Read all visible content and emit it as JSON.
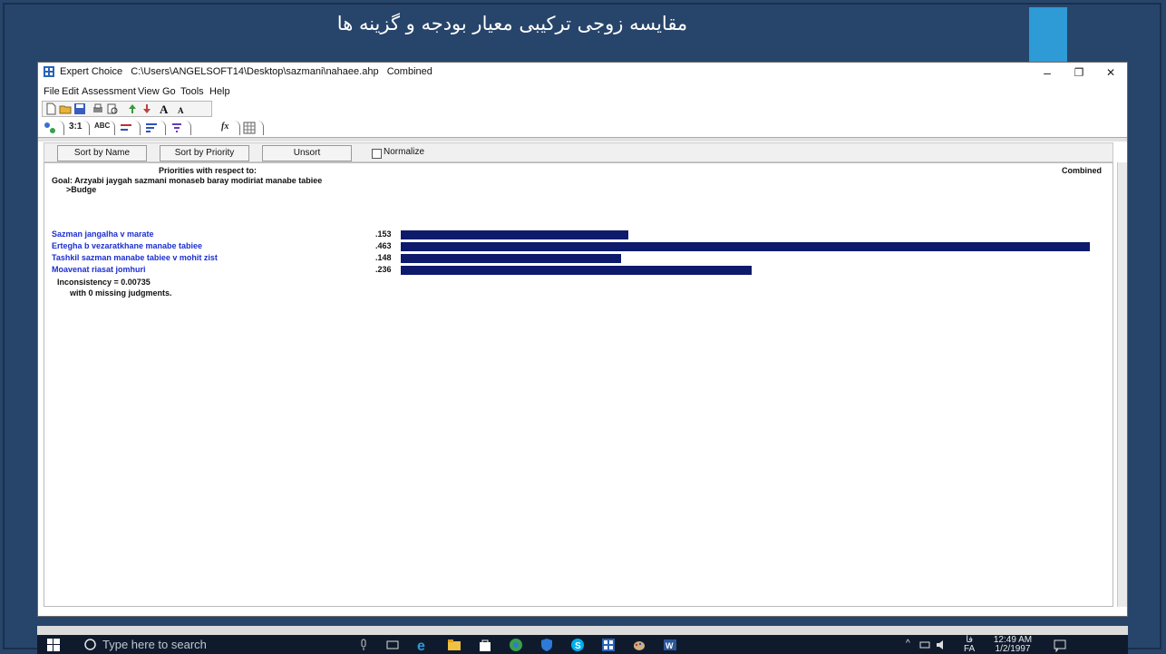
{
  "slide": {
    "title": "مقایسه زوجی ترکیبی معیار بودجه و گزینه ها",
    "colors": {
      "background": "#27456a",
      "accent": "#2e9ad6"
    }
  },
  "window": {
    "app_name": "Expert Choice",
    "path": "C:\\Users\\ANGELSOFT14\\Desktop\\sazmani\\nahaee.ahp",
    "mode": "Combined",
    "controls": {
      "minimize": "–",
      "restore": "❐",
      "close": "✕"
    }
  },
  "menu": {
    "items": [
      "File",
      "Edit",
      "Assessment",
      "View",
      "Go",
      "Tools",
      "Help"
    ]
  },
  "toolbar": {
    "icons": [
      "new-file-icon",
      "open-folder-icon",
      "save-icon",
      "print-icon",
      "print-preview-icon",
      "move-up-icon",
      "move-down-icon",
      "font-larger-icon",
      "font-smaller-icon"
    ],
    "tabs": [
      "3:1",
      "ABC"
    ]
  },
  "sort_bar": {
    "sort_by_name": "Sort by Name",
    "sort_by_priority": "Sort by Priority",
    "unsort": "Unsort",
    "normalize": "Normalize",
    "normalize_checked": false
  },
  "report": {
    "heading": "Priorities with respect to:",
    "combined": "Combined",
    "goal": "Goal: Arzyabi jaygah sazmani monaseb baray modiriat manabe tabiee",
    "node": ">Budge",
    "inconsistency": "Inconsistency = 0.00735",
    "missing": "with 0  missing judgments."
  },
  "chart_data": {
    "type": "bar",
    "categories": [
      "Sazman jangalha v marate",
      "Ertegha b vezaratkhane manabe tabiee",
      "Tashkil sazman manabe tabiee v mohit zist",
      "Moavenat riasat jomhuri"
    ],
    "values": [
      0.153,
      0.463,
      0.148,
      0.236
    ],
    "labels": [
      ".153",
      ".463",
      ".148",
      ".236"
    ],
    "bar_color": "#0e1a6b"
  },
  "taskbar": {
    "search_placeholder": "Type here to search",
    "lang_top": "فا",
    "lang_bottom": "FA",
    "time": "12:49 AM",
    "date": "1/2/1997",
    "apps": [
      "task-view-icon",
      "edge-icon",
      "file-explorer-icon",
      "store-icon",
      "chrome-icon",
      "defender-icon",
      "skype-icon",
      "expert-choice-icon",
      "paint-icon",
      "word-icon"
    ]
  }
}
